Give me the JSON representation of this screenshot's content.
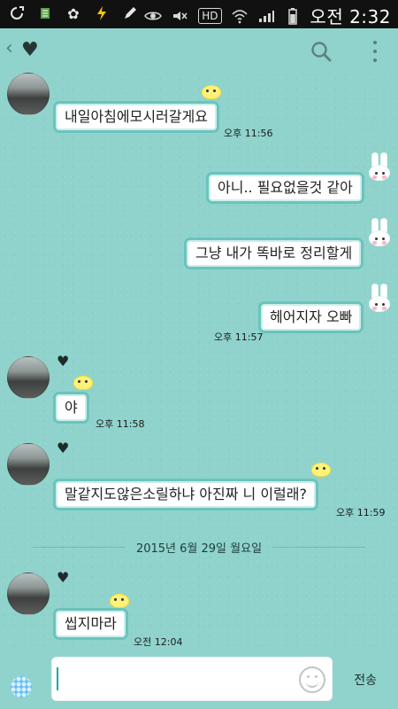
{
  "status_bar": {
    "time": "오전 2:32",
    "icons": [
      "sync-icon",
      "sim-icon",
      "flower-icon",
      "charging-icon",
      "pen-icon",
      "eye-icon",
      "mute-icon",
      "hd-icon",
      "wifi-icon",
      "signal-icon",
      "battery-icon"
    ],
    "hd_label": "HD"
  },
  "app_bar": {
    "back_icon": "back-icon",
    "profile_icon": "heart-icon",
    "search_icon": "search-icon",
    "more_icon": "more-vertical-icon"
  },
  "messages": [
    {
      "side": "left",
      "text": "내일아침에모시러갈게요",
      "time": "오후 11:56"
    },
    {
      "side": "right",
      "text": "아니.. 필요없을것 같아",
      "time": ""
    },
    {
      "side": "right",
      "text": "그냥 내가 똑바로 정리할게",
      "time": ""
    },
    {
      "side": "right",
      "text": "헤어지자 오빠",
      "time": "오후 11:57"
    },
    {
      "side": "left",
      "text": "야",
      "time": "오후 11:58"
    },
    {
      "side": "left",
      "text": "말같지도않은소릴하냐 아진짜 니 이럴래?",
      "time": "오후 11:59"
    },
    {
      "side": "left",
      "text": "씹지마라",
      "time": "오전 12:04"
    }
  ],
  "date_separator": "2015년 6월 29일 월요일",
  "input": {
    "value": "",
    "send_label": "전송"
  },
  "colors": {
    "background": "#8fd3cc",
    "bubble_border": "#6ac4bd",
    "status_bar": "#111111"
  }
}
